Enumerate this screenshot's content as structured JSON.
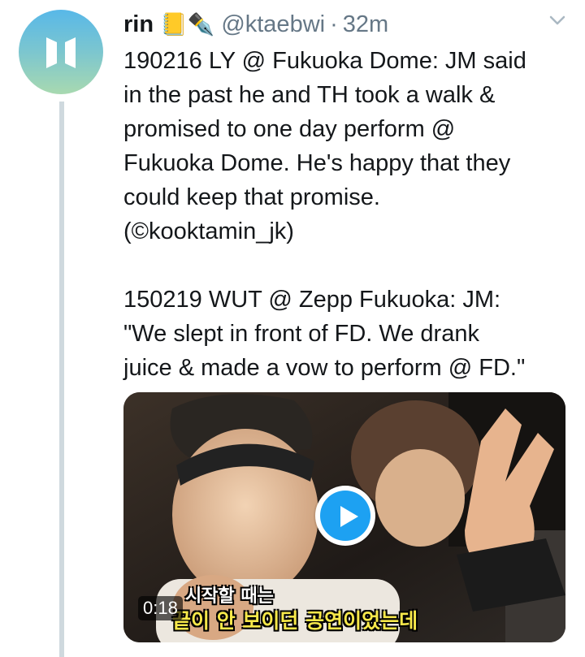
{
  "tweet": {
    "author": {
      "name": "rin",
      "emoji": "📒✒️",
      "handle": "@ktaebwi",
      "separator": "·",
      "time": "32m",
      "avatar_icon": "bts-logo-icon"
    },
    "text": "190216 LY @ Fukuoka Dome: JM said\nin the past he and TH took a walk &\npromised to one day perform @\nFukuoka Dome. He's happy that they\ncould keep that promise.\n(©kooktamin_jk)\n\n150219 WUT @ Zepp Fukuoka: JM:\n\"We slept in front of FD. We drank\njuice & made a vow to perform @ FD.\"",
    "menu_icon": "chevron-down-icon",
    "media": {
      "type": "video",
      "duration": "0:18",
      "subtitle_line1": "시작할 때는",
      "subtitle_line2": "끝이 안 보이던 공연이었는데",
      "play_icon": "play-icon"
    }
  },
  "colors": {
    "accent": "#1da1f2",
    "secondary_text": "#657786",
    "thread_line": "#cfd9de"
  }
}
